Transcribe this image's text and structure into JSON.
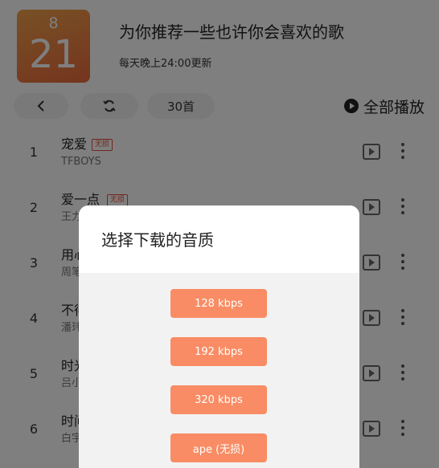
{
  "header": {
    "date_month": "8",
    "date_day": "21",
    "title": "为你推荐一些也许你会喜欢的歌",
    "subtitle": "每天晚上24:00更新"
  },
  "toolbar": {
    "back_icon": "chevron-left-icon",
    "refresh_icon": "refresh-icon",
    "count_label": "30首",
    "play_all_label": "全部播放",
    "play_all_icon": "play-circle-icon"
  },
  "songs": [
    {
      "index": "1",
      "title": "宠爱",
      "badge": "无损",
      "artist": "TFBOYS"
    },
    {
      "index": "2",
      "title": "爱一点",
      "badge": "无损",
      "artist": "王力"
    },
    {
      "index": "3",
      "title": "用心",
      "badge": "",
      "artist": "周笔"
    },
    {
      "index": "4",
      "title": "不得",
      "badge": "",
      "artist": "潘玮"
    },
    {
      "index": "5",
      "title": "时光",
      "badge": "",
      "artist": "吕小"
    },
    {
      "index": "6",
      "title": "时间",
      "badge": "",
      "artist": "白宇"
    }
  ],
  "dialog": {
    "title": "选择下载的音质",
    "options": [
      "128 kbps",
      "192 kbps",
      "320 kbps",
      "ape (无损)"
    ]
  },
  "colors": {
    "accent": "#f98c64",
    "date_card": "#ee7f43",
    "badge": "#e74c3c"
  }
}
